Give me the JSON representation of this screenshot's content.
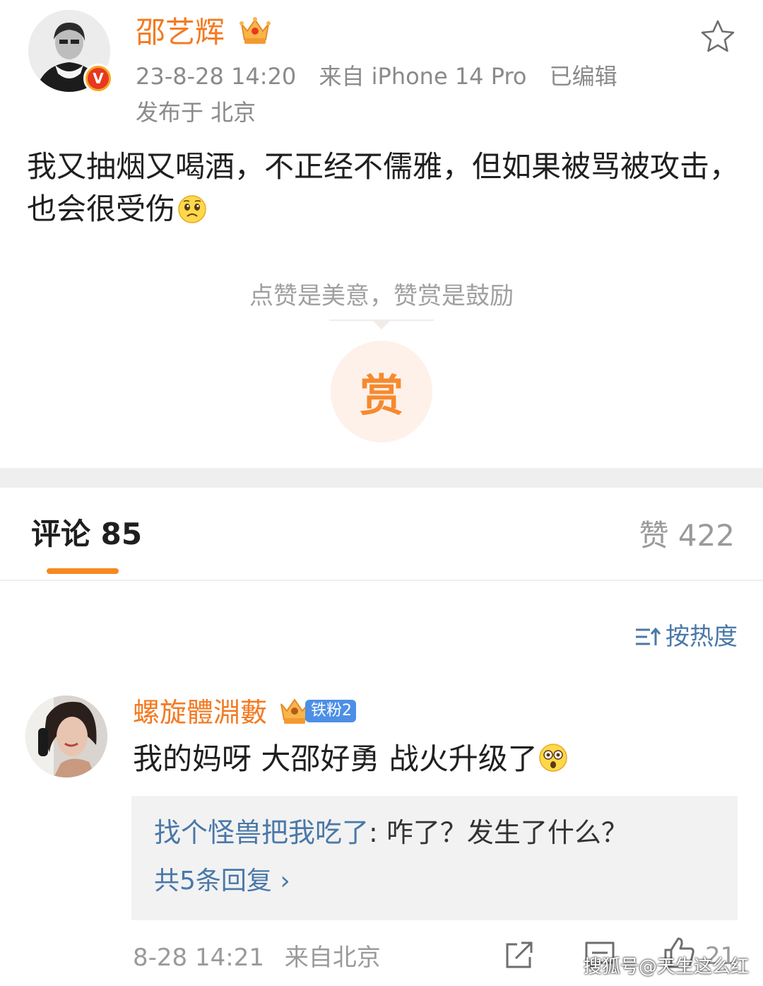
{
  "post": {
    "author": "邵艺辉",
    "time": "23-8-28 14:20",
    "source": "来自 iPhone 14 Pro",
    "edited": "已编辑",
    "location": "发布于 北京",
    "text": "我又抽烟又喝酒，不正经不儒雅，但如果被骂被攻击，也会很受伤",
    "reward_tip": "点赞是美意，赞赏是鼓励",
    "reward_button": "赏",
    "verified_badge": "V"
  },
  "tabs": {
    "comments": "评论 85",
    "likes": "赞 422"
  },
  "sort": {
    "label": "按热度"
  },
  "comment": {
    "user": "螺旋體淵藪",
    "fan_badge": "铁粉2",
    "text": "我的妈呀 大邵好勇 战火升级了",
    "reply": {
      "user": "找个怪兽把我吃了",
      "text": ": 咋了？发生了什么？",
      "more": "共5条回复 ›"
    },
    "time": "8-28 14:21",
    "source": "来自北京",
    "likes": "21"
  },
  "watermark": "搜狐号@天生这么红",
  "colors": {
    "accent_orange": "#f47a22",
    "link_blue": "#4a78a8",
    "tab_underline": "#f7891f"
  }
}
